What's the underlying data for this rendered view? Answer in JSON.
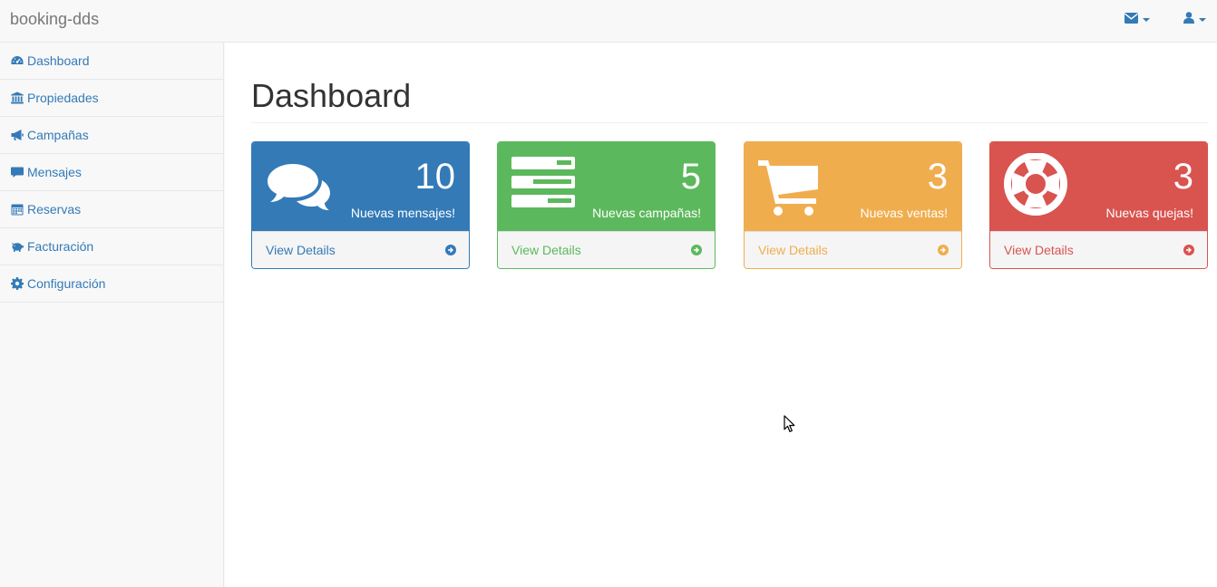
{
  "navbar": {
    "brand": "booking-dds",
    "messages_icon": "envelope-icon",
    "user_icon": "user-icon"
  },
  "sidebar": {
    "items": [
      {
        "label": "Dashboard",
        "icon": "dashboard-icon"
      },
      {
        "label": "Propiedades",
        "icon": "bank-icon"
      },
      {
        "label": "Campañas",
        "icon": "bullhorn-icon"
      },
      {
        "label": "Mensajes",
        "icon": "comment-icon"
      },
      {
        "label": "Reservas",
        "icon": "calendar-icon"
      },
      {
        "label": "Facturación",
        "icon": "piggy-bank-icon"
      },
      {
        "label": "Configuración",
        "icon": "gear-icon"
      }
    ]
  },
  "main": {
    "title": "Dashboard",
    "panels": [
      {
        "count": "10",
        "label": "Nuevas mensajes!",
        "link": "View Details",
        "icon": "comments-icon",
        "color": "#337ab7"
      },
      {
        "count": "5",
        "label": "Nuevas campañas!",
        "link": "View Details",
        "icon": "tasks-icon",
        "color": "#5cb85c"
      },
      {
        "count": "3",
        "label": "Nuevas ventas!",
        "link": "View Details",
        "icon": "shopping-cart-icon",
        "color": "#f0ad4e"
      },
      {
        "count": "3",
        "label": "Nuevas quejas!",
        "link": "View Details",
        "icon": "support-icon",
        "color": "#d9534f"
      }
    ]
  }
}
